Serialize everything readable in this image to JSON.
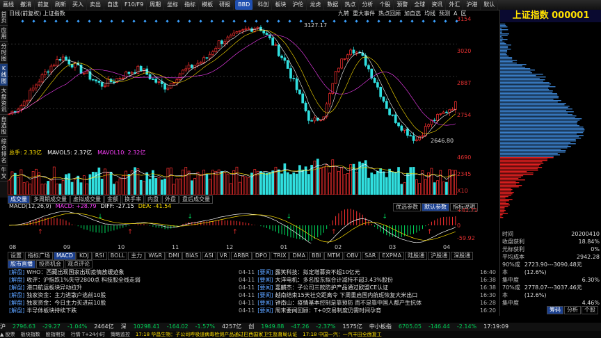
{
  "toolbar": [
    "画线",
    "撤消",
    "前复",
    "刷新",
    "买入",
    "卖出",
    "自选",
    "F10/F9",
    "周期",
    "坐标",
    "指标",
    "模板",
    "研报",
    "BBD",
    "科创",
    "板块",
    "沪伦",
    "龙虎",
    "数据",
    "热点",
    "分析",
    "个股",
    "预警",
    "全球",
    "资讯",
    "外汇",
    "沪港",
    "默认"
  ],
  "vtabs": [
    {
      "label": "首页",
      "active": false
    },
    {
      "label": "应用",
      "active": false
    },
    {
      "label": "分时图",
      "active": false
    },
    {
      "label": "K线图",
      "active": true
    },
    {
      "label": "大盘资讯",
      "active": false
    },
    {
      "label": "自选股",
      "active": false
    },
    {
      "label": "综合排名",
      "active": false
    },
    {
      "label": "牛叉",
      "active": false
    }
  ],
  "title": "日线(前复权) 上证指数",
  "topright": [
    "九转",
    "重大事件",
    "热点回顾",
    "加自选",
    "均线",
    "预测",
    "A",
    "区"
  ],
  "kline": {
    "axis": [
      "3154",
      "3020",
      "2887",
      "2754"
    ],
    "high_label": "3127.17",
    "low_label": "2646.80",
    "ylim": [
      2620,
      3160
    ]
  },
  "vol": {
    "legend": [
      "总手: 2.33亿",
      "MAVOL5: 2.37亿",
      "MAVOL10: 2.32亿"
    ],
    "axis": [
      "4690",
      "2345",
      "X10"
    ]
  },
  "tabs1": [
    {
      "label": "成交量",
      "on": true
    },
    {
      "label": "多周期成交量",
      "on": false
    },
    {
      "label": "虚拟成交量",
      "on": false
    },
    {
      "label": "金额",
      "on": false
    },
    {
      "label": "换手率",
      "on": false
    },
    {
      "label": "内盘",
      "on": false
    },
    {
      "label": "外盘",
      "on": false
    },
    {
      "label": "盘后成交量",
      "on": false
    }
  ],
  "tabs1r": [
    "优选参数",
    "默认参数",
    "指标说明"
  ],
  "macd": {
    "legend": [
      "MACD(12,26,9)",
      "MACD: +28.79",
      "DIFF: -27.15",
      "DEA: -41.54"
    ],
    "axis": [
      "+41.71",
      "0",
      "-59.92"
    ]
  },
  "dates": [
    "08",
    "09",
    "10",
    "11",
    "12",
    "01",
    "02",
    "03",
    "04"
  ],
  "tabs2": [
    {
      "label": "设置",
      "on": false
    },
    {
      "label": "指标广场",
      "on": false
    },
    {
      "label": "MACD",
      "on": true
    },
    {
      "label": "KDJ",
      "on": false
    },
    {
      "label": "RSI",
      "on": false
    },
    {
      "label": "BOLL",
      "on": false
    },
    {
      "label": "主力",
      "on": false
    },
    {
      "label": "W&R",
      "on": false
    },
    {
      "label": "DMI",
      "on": false
    },
    {
      "label": "BIAS",
      "on": false
    },
    {
      "label": "ASI",
      "on": false
    },
    {
      "label": "VR",
      "on": false
    },
    {
      "label": "ARBR",
      "on": false
    },
    {
      "label": "DPO",
      "on": false
    },
    {
      "label": "TRIX",
      "on": false
    },
    {
      "label": "DMA",
      "on": false
    },
    {
      "label": "BBI",
      "on": false
    },
    {
      "label": "MTM",
      "on": false
    },
    {
      "label": "OBV",
      "on": false
    },
    {
      "label": "SAR",
      "on": false
    },
    {
      "label": "EXPMA",
      "on": false
    },
    {
      "label": "陆股通",
      "on": false
    },
    {
      "label": "沪股通",
      "on": false
    },
    {
      "label": "深股通",
      "on": false
    }
  ],
  "newsTabs": [
    "股市直播",
    "投资机会",
    "观点评论"
  ],
  "newsLeft": [
    {
      "tag": "[解盘]",
      "text": "WHO：西藏出现国家出现疫情放缓迹象",
      "time": "16:56"
    },
    {
      "tag": "[解盘]",
      "text": "收评：沪指跌1%失守2800点 科技股全线走弱",
      "time": "15:30"
    },
    {
      "tag": "[解盘]",
      "text": "港口航运板块异动拉升",
      "time": "15:22"
    },
    {
      "tag": "[解盘]",
      "text": "独家资金：主力进散户逃前10股",
      "time": "15:16"
    },
    {
      "tag": "[解盘]",
      "text": "独家资金：今日主力买进前10股",
      "time": "15:10"
    },
    {
      "tag": "[解盘]",
      "text": "半导体板块持续下跌",
      "time": "15:01"
    }
  ],
  "newsRight": [
    {
      "date": "04-11",
      "tag": "[要闻]",
      "text": "露笑科技：拟定增募资不超10亿元",
      "time": "16:40"
    },
    {
      "date": "04-11",
      "tag": "[要闻]",
      "text": "大洋电机：多名股东拟合计减持不超3.43%股份",
      "time": "16:38"
    },
    {
      "date": "04-11",
      "tag": "[要闻]",
      "text": "嘉麟杰：子公司三款防护产品通过欧盟CE认证",
      "time": "16:38"
    },
    {
      "date": "04-11",
      "tag": "[要闻]",
      "text": "越南结束15天社交距离令 下周重启国内航班恢复大米出口",
      "time": "16:30"
    },
    {
      "date": "04-11",
      "tag": "[要闻]",
      "text": "钟南山：疫情基本控制是靠预防 而不是靠中国人都产生抗体",
      "time": "16:28"
    },
    {
      "date": "04-11",
      "tag": "[要闻]",
      "text": "周末要闻回顾：T+0交易制度仍需时间孕育",
      "time": "16:20"
    }
  ],
  "rpanel": {
    "title": "上证指数 000001",
    "info": [
      {
        "k": "时间",
        "v": "20200410"
      },
      {
        "k": "收盘获利",
        "v": "18.84%"
      },
      {
        "k": "光标获利",
        "v": "0%"
      },
      {
        "k": "平均成本",
        "v": "2942.28"
      },
      {
        "k": "90%成本",
        "v": "2723.90---3090.48元(12.6%)"
      },
      {
        "k": "集中度",
        "v": "6.30%"
      },
      {
        "k": "70%成本",
        "v": "2778.07---3037.46元(12.6%)"
      },
      {
        "k": "集中度",
        "v": "4.46%"
      }
    ],
    "tabs": [
      "筹码",
      "分析",
      "个股"
    ]
  },
  "status": [
    {
      "t": "沪",
      "c": "#ddd"
    },
    {
      "t": "2796.63",
      "c": "#00cc55"
    },
    {
      "t": "-29.27",
      "c": "#00cc55"
    },
    {
      "t": "-1.04%",
      "c": "#00cc55"
    },
    {
      "t": "2464亿",
      "c": "#ddd"
    },
    {
      "t": "深",
      "c": "#ddd"
    },
    {
      "t": "10298.41",
      "c": "#00cc55"
    },
    {
      "t": "-164.02",
      "c": "#00cc55"
    },
    {
      "t": "-1.57%",
      "c": "#00cc55"
    },
    {
      "t": "4257亿",
      "c": "#ddd"
    },
    {
      "t": "创",
      "c": "#ddd"
    },
    {
      "t": "1949.88",
      "c": "#00cc55"
    },
    {
      "t": "-47.26",
      "c": "#00cc55"
    },
    {
      "t": "-2.37%",
      "c": "#00cc55"
    },
    {
      "t": "1575亿",
      "c": "#ddd"
    },
    {
      "t": "中小板指",
      "c": "#ddd"
    },
    {
      "t": "6705.05",
      "c": "#00cc55"
    },
    {
      "t": "-146.44",
      "c": "#00cc55"
    },
    {
      "t": "-2.14%",
      "c": "#00cc55"
    },
    {
      "t": "17:19:09",
      "c": "#ddd"
    }
  ],
  "bottom": [
    "▲ 股票",
    "板块指数",
    "股指期货",
    "行情 T+24小时",
    "策略监控",
    "17:18 华昌生物：子公司呼吸道病毒检测产品通过巴西国家卫生监督局认证",
    "17:18 中国一汽：一汽丰田全面复工"
  ]
}
